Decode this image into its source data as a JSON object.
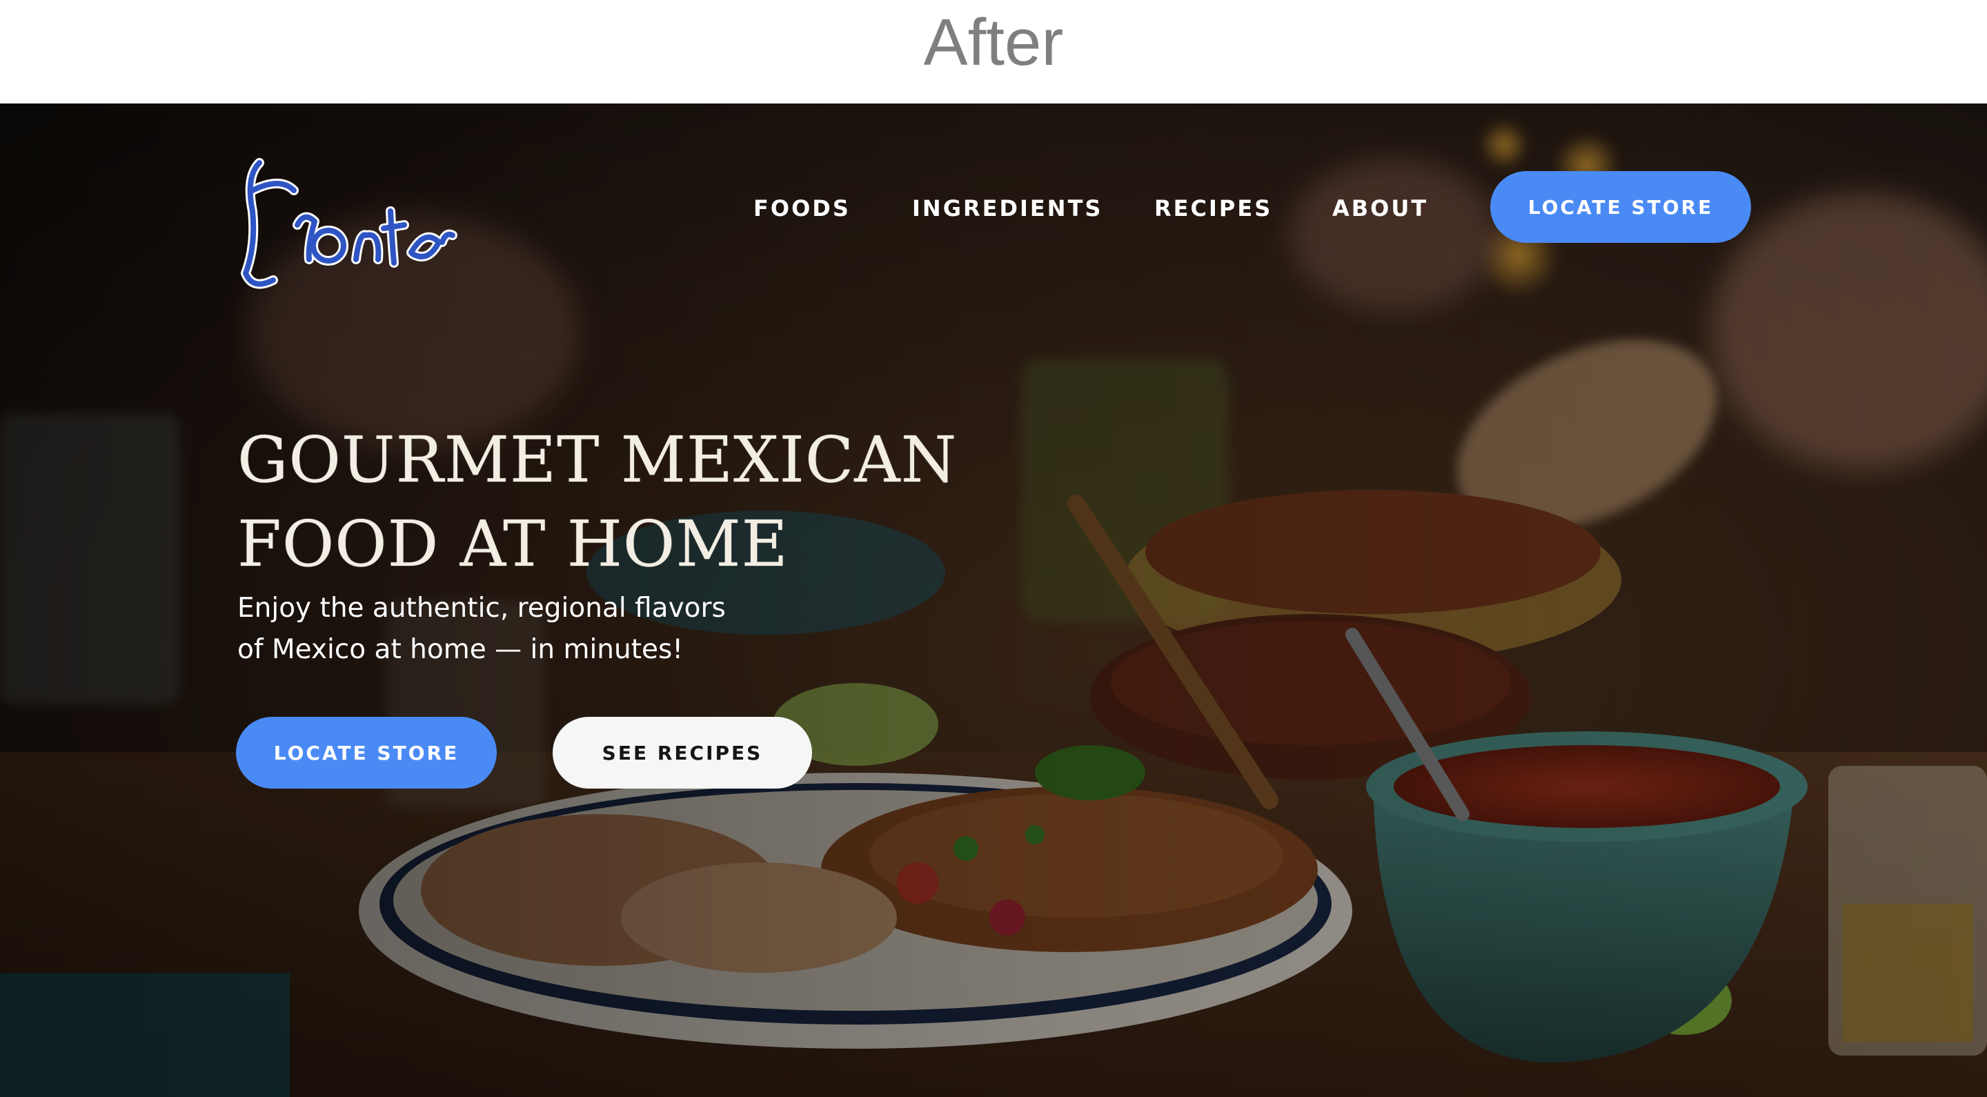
{
  "caption": "After",
  "brand": {
    "logo_text": "Frontera"
  },
  "nav": {
    "items": [
      {
        "label": "FOODS"
      },
      {
        "label": "INGREDIENTS"
      },
      {
        "label": "RECIPES"
      },
      {
        "label": "ABOUT"
      }
    ],
    "cta_label": "LOCATE STORE"
  },
  "hero": {
    "headline_line1": "GOURMET MEXICAN",
    "headline_line2": "FOOD AT HOME",
    "subtext_line1": "Enjoy the authentic, regional flavors",
    "subtext_line2": "of Mexico at home — in minutes!",
    "primary_button": "LOCATE STORE",
    "secondary_button": "SEE RECIPES",
    "background": "food-spread-photo"
  },
  "colors": {
    "accent_blue": "#4a8af4",
    "logo_blue": "#2f55c4",
    "button_white": "#f6f6f6",
    "caption_gray": "#7f7f7f"
  }
}
